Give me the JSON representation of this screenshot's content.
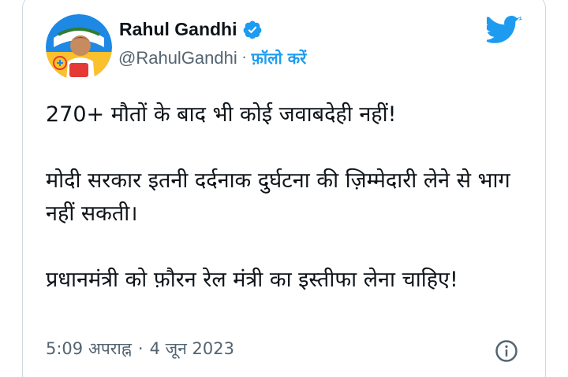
{
  "author": {
    "name": "Rahul Gandhi",
    "handle": "@RahulGandhi",
    "verified": true,
    "avatar_icon": "congress-party-avatar-icon",
    "avatar_colors": [
      "#1e88e5",
      "#fbc02d",
      "#e53935",
      "#2e7d32"
    ]
  },
  "header": {
    "separator": "·",
    "follow_label": "फ़ॉलो करें",
    "logo_icon": "twitter-bird-icon"
  },
  "tweet": {
    "paragraphs": [
      "270+ मौतों के बाद भी कोई जवाबदेही नहीं!",
      "मोदी सरकार इतनी दर्दनाक दुर्घटना की ज़िम्मेदारी लेने से भाग नहीं सकती।",
      "प्रधानमंत्री को फ़ौरन रेल मंत्री का इस्तीफा लेना चाहिए!"
    ]
  },
  "meta": {
    "time": "5:09 अपराह्न",
    "separator": "·",
    "date": "4 जून 2023",
    "info_icon": "info-icon"
  },
  "colors": {
    "accent": "#1d9bf0",
    "text": "#0f1419",
    "secondary": "#536471",
    "border": "#cfd9de"
  }
}
